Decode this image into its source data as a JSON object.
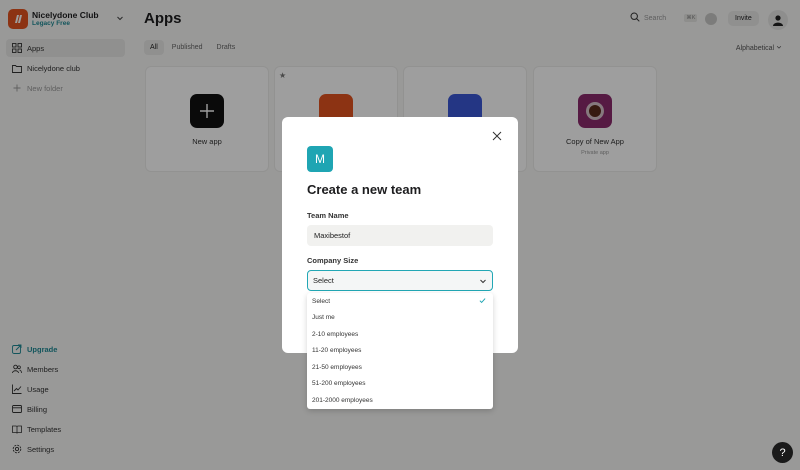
{
  "sidebar": {
    "workspace": {
      "name": "Nicelydone Club",
      "plan": "Legacy Free"
    },
    "nav": [
      {
        "label": "Apps",
        "icon": "grid-icon"
      },
      {
        "label": "Nicelydone club",
        "icon": "folder-icon"
      },
      {
        "label": "New folder",
        "icon": "plus-icon"
      }
    ],
    "bottom": [
      {
        "label": "Upgrade",
        "icon": "upgrade-icon"
      },
      {
        "label": "Members",
        "icon": "members-icon"
      },
      {
        "label": "Usage",
        "icon": "usage-icon"
      },
      {
        "label": "Billing",
        "icon": "billing-icon"
      },
      {
        "label": "Templates",
        "icon": "templates-icon"
      },
      {
        "label": "Settings",
        "icon": "settings-icon"
      }
    ]
  },
  "header": {
    "title": "Apps",
    "search_label": "Search",
    "search_shortcut": "⌘K",
    "invite_label": "Invite"
  },
  "tabs": [
    "All",
    "Published",
    "Drafts"
  ],
  "sort_label": "Alphabetical",
  "cards": [
    {
      "title": "New app",
      "subtitle": "",
      "icon_color": "#111111"
    },
    {
      "title": "",
      "subtitle": "",
      "icon_color": "#e2531f"
    },
    {
      "title": "",
      "subtitle": "",
      "icon_color": "#3a58d6"
    },
    {
      "title": "Copy of New App",
      "subtitle": "Private app",
      "icon_color": "#8c2a6c"
    }
  ],
  "modal": {
    "badge_letter": "M",
    "title": "Create a new team",
    "team_name_label": "Team Name",
    "team_name_value": "Maxibestof",
    "company_size_label": "Company Size",
    "company_size_value": "Select",
    "options": [
      "Select",
      "Just me",
      "2-10 employees",
      "11-20 employees",
      "21-50 employees",
      "51-200 employees",
      "201-2000 employees"
    ],
    "selected_option": "Select"
  },
  "help_label": "?",
  "colors": {
    "accent": "#1fa5b3",
    "brand": "#e2531f"
  }
}
